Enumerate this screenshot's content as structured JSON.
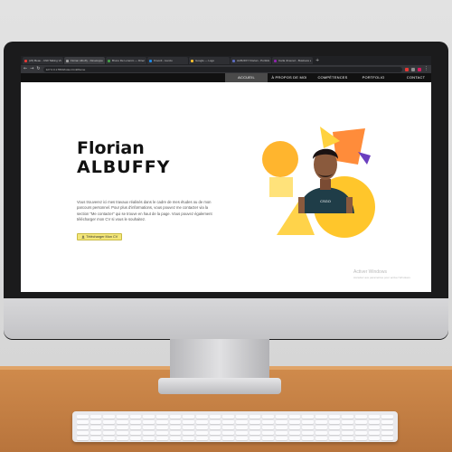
{
  "browser": {
    "tabs": [
      {
        "title": "(23) Beau - Chill Talking Vid",
        "color": "#e53935",
        "active": false
      },
      {
        "title": "Florian Albuffy - Développeur Web",
        "color": "#9e9e9e",
        "active": true
      },
      {
        "title": "Bruno De Lorenzo — Directeur",
        "color": "#43a047",
        "active": false
      },
      {
        "title": "Kroonli - Lienzo",
        "color": "#1e88e5",
        "active": false
      },
      {
        "title": "Google — Logo",
        "color": "#fbc02d",
        "active": false
      },
      {
        "title": "ALBUFFY Florian - Portfolio",
        "color": "#5c6bc0",
        "active": false
      },
      {
        "title": "Carla Jimenez - Business et Di",
        "color": "#8e24aa",
        "active": false
      }
    ],
    "url": "127.0.0.1:5500/index.html#home"
  },
  "nav": {
    "items": [
      {
        "label": "ACCUEIL",
        "active": true
      },
      {
        "label": "À PROPOS DE MOI",
        "active": false
      },
      {
        "label": "COMPÉTENCES",
        "active": false
      },
      {
        "label": "PORTFOLIO",
        "active": false
      },
      {
        "label": "CONTACT",
        "active": false
      }
    ]
  },
  "hero": {
    "first_name": "Florian",
    "last_name": "ALBUFFY",
    "description": "Vous trouverez ici mes travaux réalisés dans le cadre de mes études ou de mon parcours personnel. Pour plus d'informations, vous pouvez me contacter via la section \"Me contacter\" qui se trouve en haut de la page. Vous pouvez également télécharger mon CV si vous le souhaitez.",
    "cv_button": "Télécharger Mon CV",
    "tshirt_text": "CSGO"
  },
  "watermark": {
    "title": "Activer Windows",
    "subtitle": "Accédez aux paramètres pour activer Windows."
  },
  "colors": {
    "accent_yellow": "#f3e679",
    "shape_orange": "#ff8c3a",
    "shape_yellow": "#ffc62b",
    "shape_violet": "#6b3fbf",
    "nav_bg": "#111111"
  }
}
